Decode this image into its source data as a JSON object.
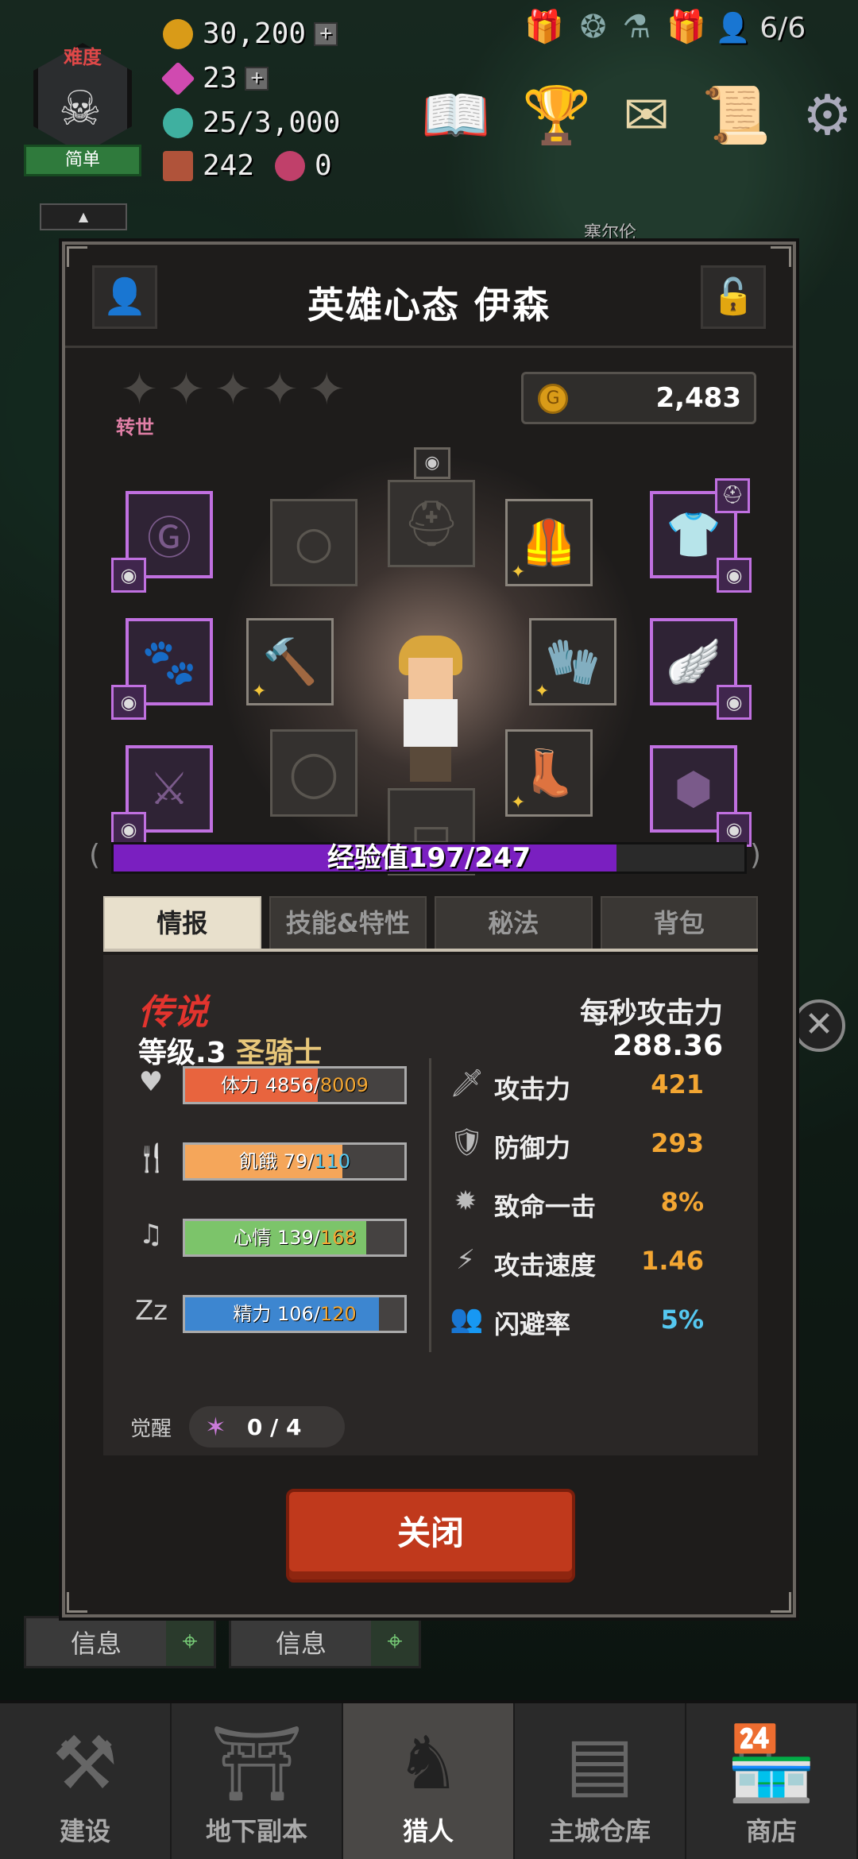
{
  "hud": {
    "difficulty_title": "难度",
    "difficulty_level": "简单",
    "gold": "30,200",
    "gems": "23",
    "crystals": "25/3,000",
    "items": "242",
    "orbs": "0",
    "hero_count": "6/6",
    "place_name": "塞尔伦",
    "icons": [
      "book-icon",
      "trophy-icon",
      "mail-icon",
      "quest-icon",
      "settings-icon"
    ]
  },
  "modal": {
    "title": "英雄心态 伊森",
    "rebirth_label": "转世",
    "gold_amount": "2,483",
    "stars_filled": 0,
    "stars_total": 5,
    "xp_text": "经验值197/247",
    "xp_fraction": 0.7976,
    "tabs": [
      {
        "label": "情报",
        "active": true
      },
      {
        "label": "技能&特性",
        "active": false
      },
      {
        "label": "秘法",
        "active": false
      },
      {
        "label": "背包",
        "active": false
      }
    ],
    "info": {
      "rarity": "传说",
      "level_prefix": "等级.3",
      "class_name": "圣骑士",
      "dps_label": "每秒攻击力",
      "dps_value": "288.36",
      "vitals": [
        {
          "label": "体力",
          "current": "4856",
          "max": "8009",
          "fraction": 0.606,
          "color": "#e8643e",
          "max_color": "orange"
        },
        {
          "label": "飢餓",
          "current": "79",
          "max": "110",
          "fraction": 0.718,
          "color": "#f5a65a",
          "max_color": "blue"
        },
        {
          "label": "心情",
          "current": "139",
          "max": "168",
          "fraction": 0.827,
          "color": "#7cc46a",
          "max_color": "orange"
        },
        {
          "label": "精力",
          "current": "106",
          "max": "120",
          "fraction": 0.883,
          "color": "#3d86d0",
          "max_color": "orange"
        }
      ],
      "stats": [
        {
          "name": "攻击力",
          "value": "421",
          "color": "orange"
        },
        {
          "name": "防御力",
          "value": "293",
          "color": "orange"
        },
        {
          "name": "致命一击",
          "value": "8%",
          "color": "orange"
        },
        {
          "name": "攻击速度",
          "value": "1.46",
          "color": "orange"
        },
        {
          "name": "闪避率",
          "value": "5%",
          "color": "blue"
        }
      ],
      "awaken_label": "觉醒",
      "awaken_value": "0 / 4"
    },
    "close_label": "关闭"
  },
  "side": {
    "info_label_1": "信息",
    "info_label_2": "信息"
  },
  "bottom_nav": [
    {
      "label": "建设",
      "icon": "hammer-wrench-icon",
      "active": false
    },
    {
      "label": "地下副本",
      "icon": "dungeon-gate-icon",
      "active": false
    },
    {
      "label": "猎人",
      "icon": "hunter-emblem-icon",
      "active": true
    },
    {
      "label": "主城仓库",
      "icon": "storage-chest-icon",
      "active": false
    },
    {
      "label": "商店",
      "icon": "shop-icon",
      "active": false
    }
  ]
}
